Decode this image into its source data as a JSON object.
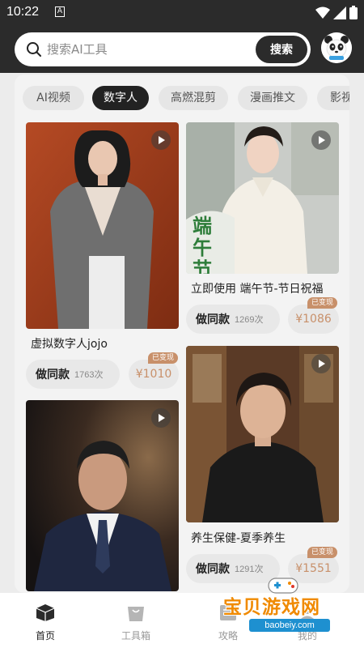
{
  "status_bar": {
    "time": "10:22",
    "notification_icon": "A"
  },
  "header": {
    "search_placeholder": "搜索AI工具",
    "search_button": "搜索"
  },
  "tabs": [
    "AI视频",
    "数字人",
    "高燃混剪",
    "漫画推文",
    "影视"
  ],
  "active_tab": "数字人",
  "cards": [
    {
      "title": "虚拟数字人jojo",
      "do_label": "做同款",
      "count": "1763次",
      "badge": "已变现",
      "price": "¥1010"
    },
    {
      "title": "立即使用 端午节-节日祝福",
      "do_label": "做同款",
      "count": "1269次",
      "badge": "已变现",
      "price": "¥1086",
      "poster_text": "端午节"
    },
    {
      "title": "养生保健-夏季养生",
      "do_label": "做同款",
      "count": "1291次",
      "badge": "已变现",
      "price": "¥1551"
    }
  ],
  "bottom_nav": [
    {
      "label": "首页",
      "icon": "box-icon",
      "active": true
    },
    {
      "label": "工具箱",
      "icon": "toolbox-icon",
      "active": false
    },
    {
      "label": "攻略",
      "icon": "guide-icon",
      "active": false
    },
    {
      "label": "我的",
      "icon": "user-icon",
      "active": false
    }
  ],
  "watermark": {
    "text": "宝贝游戏网",
    "url": "baobeiy.com"
  },
  "colors": {
    "dark": "#2b2b2b",
    "accent": "#c8906a",
    "page_bg": "#f3f3f3"
  }
}
